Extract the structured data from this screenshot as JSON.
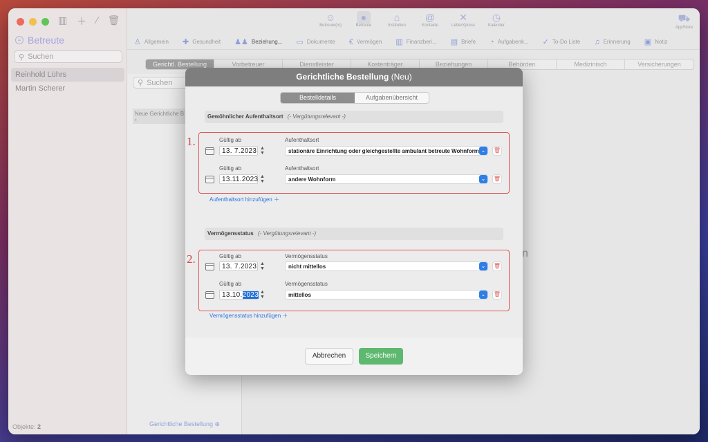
{
  "sidebar": {
    "title": "Betreute",
    "search_placeholder": "Suchen",
    "items": [
      {
        "label": "Reinhold Lührs"
      },
      {
        "label": "Martin Scherer"
      }
    ],
    "footer_label": "Objekte:",
    "footer_count": "2"
  },
  "topnav": {
    "items": [
      {
        "label": "Betreuer(in)",
        "icon": "people-icon"
      },
      {
        "label": "Betreute",
        "icon": "person-icon"
      },
      {
        "label": "Institution",
        "icon": "building-icon"
      },
      {
        "label": "Kontakte",
        "icon": "at-icon"
      },
      {
        "label": "LetterXpress",
        "icon": "letter-icon"
      },
      {
        "label": "Kalender",
        "icon": "clock-icon"
      }
    ],
    "appstore_label": "AppStore"
  },
  "subnav": {
    "items": [
      "Allgemein",
      "Gesundheit",
      "Beziehung...",
      "Dokumente",
      "Vermögen",
      "Finanzberi...",
      "Briefe",
      "Aufgabenk...",
      "To-Do Liste",
      "Erinnerung",
      "Notiz"
    ]
  },
  "tabs": [
    "Gerichtl. Bestellung",
    "Vorbetreuer",
    "Dienstleister",
    "Kostenträger",
    "Beziehungen",
    "Behörden",
    "Medizinisch",
    "Versicherungen"
  ],
  "listpane": {
    "search_placeholder": "Suchen",
    "item_label": "Neue Gerichtliche B",
    "footer_label": "Gerichtliche Bestellung"
  },
  "background_text": "n",
  "modal": {
    "title": "Gerichtliche Bestellung",
    "title_suffix": "(Neu)",
    "segments": [
      "Bestelldetails",
      "Aufgabenübersicht"
    ],
    "section1": {
      "title": "Gewöhnlicher Aufenthaltsort",
      "note": "(- Vergütungsrelevant -)",
      "marker": "1.",
      "rows": [
        {
          "date_label": "Gültig ab",
          "date_pre": "13.  7.",
          "date_year": "2023",
          "field_label": "Aufenthaltsort",
          "value": "stationäre Einrichtung oder gleichgestellte ambulant betreute Wohnform"
        },
        {
          "date_label": "Gültig ab",
          "date_pre": "13.11.",
          "date_year": "2023",
          "field_label": "Aufenthaltsort",
          "value": "andere Wohnform"
        }
      ],
      "add_label": "Aufenthaltsort hinzufügen"
    },
    "section2": {
      "title": "Vermögensstatus",
      "note": "(- Vergütungsrelevant -)",
      "marker": "2.",
      "rows": [
        {
          "date_label": "Gültig ab",
          "date_pre": "13.  7.",
          "date_year": "2023",
          "field_label": "Vermögensstatus",
          "value": "nicht mittellos"
        },
        {
          "date_label": "Gültig ab",
          "date_pre": "13.10.",
          "date_year": "2023",
          "field_label": "Vermögensstatus",
          "value": "mittellos"
        }
      ],
      "add_label": "Vermögensstatus hinzufügen"
    },
    "cancel_label": "Abbrechen",
    "save_label": "Speichern"
  },
  "colors": {
    "accent": "#2e7ee8",
    "save": "#5eb870",
    "marker": "#d64545"
  }
}
